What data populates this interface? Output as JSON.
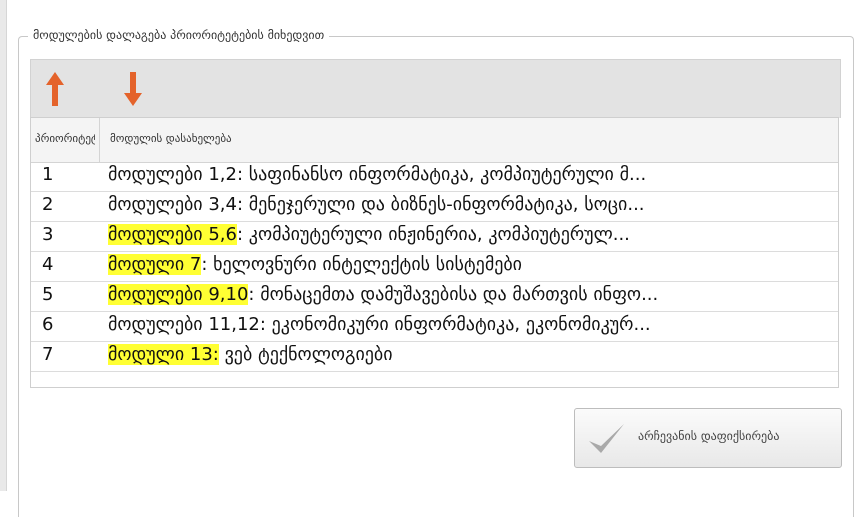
{
  "group": {
    "title": "მოდულების დალაგება პრიორიტეტების მიხედვით"
  },
  "toolbar": {
    "move_up_icon": "arrow-up-icon",
    "move_down_icon": "arrow-down-icon",
    "arrow_color": "#e4632b"
  },
  "table": {
    "headers": {
      "priority": "პრიორიტეტი",
      "module_name": "მოდულის დასახელება"
    },
    "rows": [
      {
        "priority": "1",
        "highlight": "",
        "rest": "მოდულები 1,2: საფინანსო ინფორმატიკა, კომპიუტერული მ..."
      },
      {
        "priority": "2",
        "highlight": "",
        "rest": "მოდულები 3,4: მენეჯერული და ბიზნეს-ინფორმატიკა, სოცი..."
      },
      {
        "priority": "3",
        "highlight": "მოდულები 5,6",
        "rest": ": კომპიუტერული ინჟინერია, კომპიუტერულ..."
      },
      {
        "priority": "4",
        "highlight": "მოდული 7",
        "rest": ": ხელოვნური ინტელექტის სისტემები"
      },
      {
        "priority": "5",
        "highlight": "მოდულები 9,10",
        "rest": ": მონაცემთა დამუშავებისა და მართვის ინფო..."
      },
      {
        "priority": "6",
        "highlight": "",
        "rest": "მოდულები 11,12: ეკონომიკური ინფორმატიკა, ეკონომიკურ..."
      },
      {
        "priority": "7",
        "highlight": "მოდული 13:",
        "rest": " ვებ ტექნოლოგიები"
      }
    ]
  },
  "confirm": {
    "label": "არჩევანის დაფიქსირება",
    "icon": "checkmark-icon"
  },
  "colors": {
    "highlight": "#ffff33",
    "toolbar_bg": "#e3e3e3"
  }
}
